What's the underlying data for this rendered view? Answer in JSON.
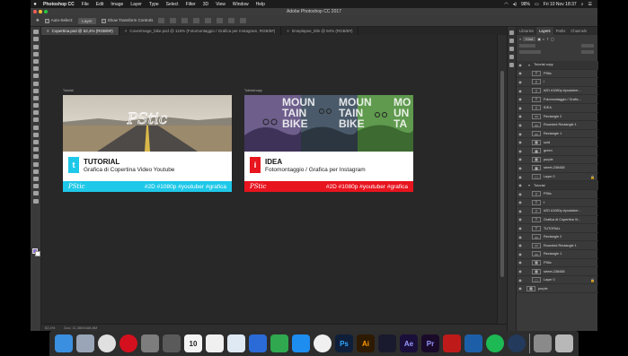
{
  "menubar": {
    "app": "Photoshop CC",
    "items": [
      "File",
      "Edit",
      "Image",
      "Layer",
      "Type",
      "Select",
      "Filter",
      "3D",
      "View",
      "Window",
      "Help"
    ],
    "battery": "98%",
    "clock": "Fri 10 Nov  18:37"
  },
  "window": {
    "title": "Adobe Photoshop CC 2017"
  },
  "options": {
    "auto_select": "Auto-Select:",
    "auto_select_value": "Layer",
    "transform": "Show Transform Controls"
  },
  "tabs": [
    {
      "label": "Copertina.psd @ 52,4% (RGB/8#)",
      "active": true
    },
    {
      "label": "Coverimage_bike.psd @ 115% (Fotomontaggio / Grafica per Instagram, RGB/8#)",
      "active": false
    },
    {
      "label": "timeplapse_title @ 94% (RGB/8#)",
      "active": false
    }
  ],
  "artboards": [
    {
      "label": "Tutorial",
      "title": "TUTORIAL",
      "subtitle": "Grafica di Copertina Video Youtube",
      "logo": "PStic",
      "tags": "#2D #1080p #youtuber #grafica",
      "accent": "#1ec8e8",
      "icon": "t"
    },
    {
      "label": "Tutorial copy",
      "title": "IDEA",
      "subtitle": "Fotomontaggio / Grafica per Instagram",
      "logo": "PStic",
      "tags": "#2D #1080p #youtuber #grafica",
      "accent": "#e8141e",
      "icon": "i"
    }
  ],
  "status": {
    "zoom": "52,4%",
    "doc": "Doc: 11,36M/168,8M"
  },
  "panel": {
    "tabs": [
      "Libraries",
      "Layers",
      "Paths",
      "Channels"
    ],
    "filter": "Kind",
    "layers": [
      {
        "name": "Tutorial copy",
        "type": "group"
      },
      {
        "name": "PStic",
        "type": "text",
        "indent": true
      },
      {
        "name": "i",
        "type": "text",
        "indent": true
      },
      {
        "name": "#2D #1080p #youtuber...",
        "type": "text",
        "indent": true
      },
      {
        "name": "Fotomontaggio / Grafic...",
        "type": "text",
        "indent": true
      },
      {
        "name": "IDEA",
        "type": "text",
        "indent": true
      },
      {
        "name": "Rectangle 2",
        "type": "shape",
        "indent": true
      },
      {
        "name": "Rounded Rectangle 1",
        "type": "shape",
        "indent": true
      },
      {
        "name": "Rectangle 1",
        "type": "shape",
        "indent": true
      },
      {
        "name": "sold",
        "type": "image",
        "indent": true
      },
      {
        "name": "green",
        "type": "image",
        "indent": true
      },
      {
        "name": "purple",
        "type": "image",
        "indent": true
      },
      {
        "name": "street-238458",
        "type": "image",
        "indent": true
      },
      {
        "name": "Layer 0",
        "type": "fill",
        "indent": true,
        "lock": true
      },
      {
        "name": "Tutorial",
        "type": "group"
      },
      {
        "name": "PStic",
        "type": "text",
        "indent": true
      },
      {
        "name": "t",
        "type": "text",
        "indent": true
      },
      {
        "name": "#2D #1080p #youtuber...",
        "type": "text",
        "indent": true
      },
      {
        "name": "Grafica di Copertina Vi...",
        "type": "text",
        "indent": true
      },
      {
        "name": "TUTORIAL",
        "type": "text",
        "indent": true
      },
      {
        "name": "Rectangle 2",
        "type": "shape",
        "indent": true
      },
      {
        "name": "Rounded Rectangle 1",
        "type": "shape",
        "indent": true
      },
      {
        "name": "Rectangle 1",
        "type": "shape",
        "indent": true
      },
      {
        "name": "PStic",
        "type": "image",
        "indent": true
      },
      {
        "name": "street-238458",
        "type": "image",
        "indent": true
      },
      {
        "name": "Layer 0",
        "type": "fill",
        "indent": true,
        "lock": true
      },
      {
        "name": "purple",
        "type": "image"
      }
    ]
  },
  "dock": [
    "finder",
    "launchpad",
    "chrome",
    "opera",
    "system-prefs",
    "photos-scan",
    "calendar",
    "photos",
    "preview",
    "keynote",
    "numbers",
    "app-store",
    "itunes",
    "photoshop",
    "illustrator",
    "premiere-bridge",
    "after-effects",
    "premiere",
    "filezilla",
    "virtualbox",
    "spotify",
    "quicktime",
    "printer",
    "trash"
  ],
  "dock_labels": {
    "calendar": "10",
    "photoshop": "Ps",
    "illustrator": "Ai",
    "after-effects": "Ae",
    "premiere": "Pr"
  }
}
